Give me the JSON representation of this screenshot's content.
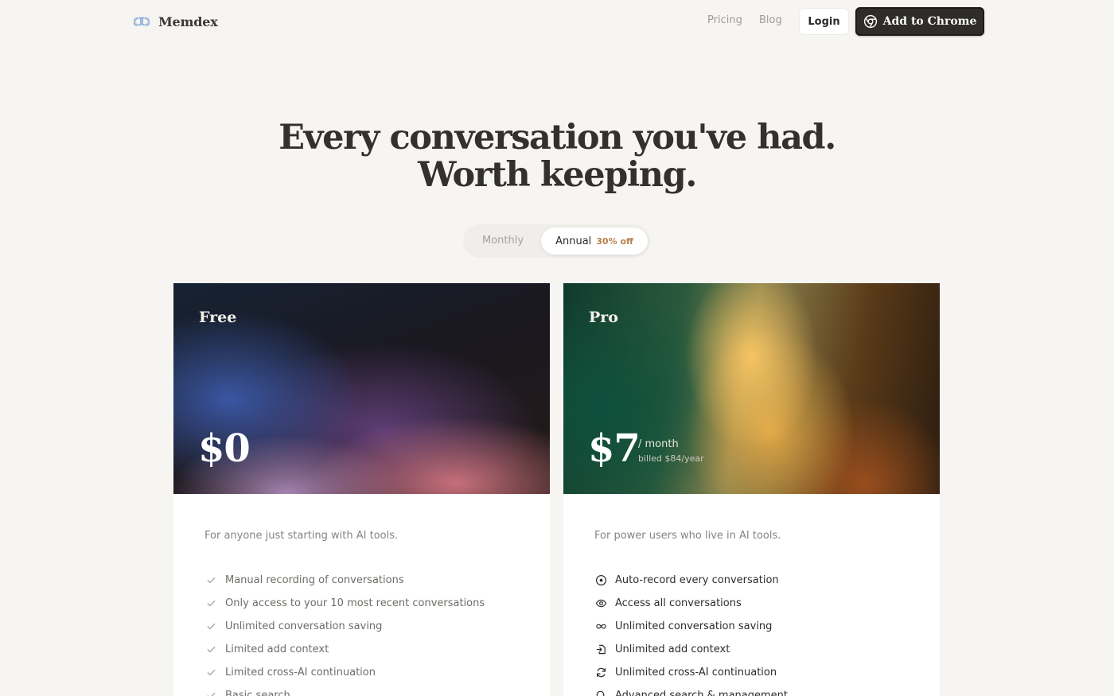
{
  "nav": {
    "brand": "Memdex",
    "links": [
      "Pricing",
      "Blog"
    ],
    "login_label": "Login",
    "cta_label": "Add to Chrome"
  },
  "hero": {
    "line1": "Every conversation you've had.",
    "line2": "Worth keeping."
  },
  "billing_toggle": {
    "monthly_label": "Monthly",
    "annual_label": "Annual",
    "annual_badge": "30% off",
    "selected": "Annual"
  },
  "plans": [
    {
      "name": "Free",
      "price": "$0",
      "description": "For anyone just starting with AI tools.",
      "features": [
        {
          "icon": "check-icon",
          "text": "Manual recording of conversations"
        },
        {
          "icon": "check-icon",
          "text": "Only access to your 10 most recent conversations"
        },
        {
          "icon": "check-icon",
          "text": "Unlimited conversation saving"
        },
        {
          "icon": "check-icon",
          "text": "Limited add context"
        },
        {
          "icon": "check-icon",
          "text": "Limited cross-AI continuation"
        },
        {
          "icon": "check-icon",
          "text": "Basic search"
        }
      ]
    },
    {
      "name": "Pro",
      "price": "$7",
      "period": "/ month",
      "billed": "billed $84/year",
      "description": "For power users who live in AI tools.",
      "features": [
        {
          "icon": "record-icon",
          "text": "Auto-record every conversation"
        },
        {
          "icon": "eye-icon",
          "text": "Access all conversations"
        },
        {
          "icon": "infinity-icon",
          "text": "Unlimited conversation saving"
        },
        {
          "icon": "add-context-icon",
          "text": "Unlimited add context"
        },
        {
          "icon": "refresh-icon",
          "text": "Unlimited cross-AI continuation"
        },
        {
          "icon": "search-icon",
          "text": "Advanced search & management"
        }
      ]
    }
  ],
  "colors": {
    "background": "#f6f5f2",
    "cta_background": "#2e2d2b",
    "badge_accent": "#b9814a"
  }
}
